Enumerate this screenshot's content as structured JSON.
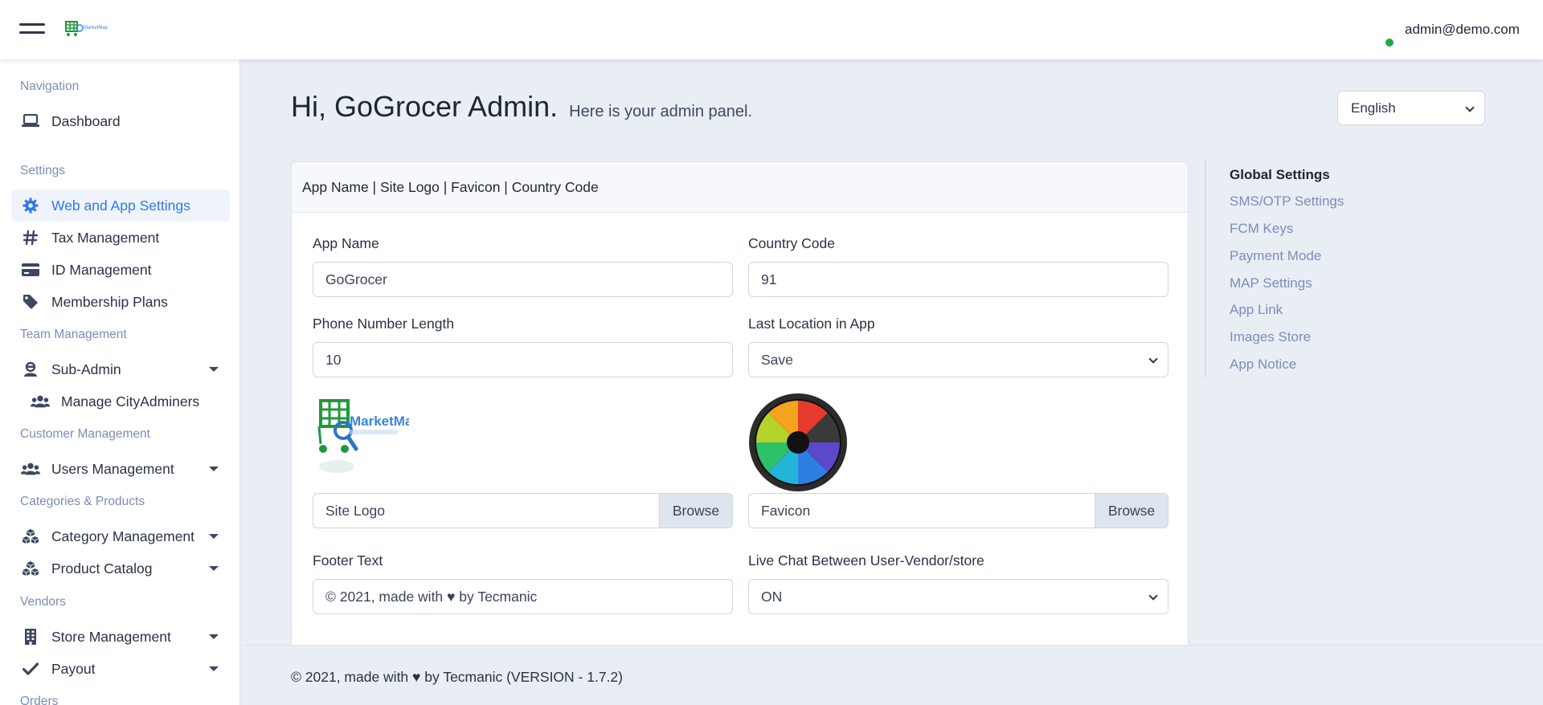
{
  "header": {
    "brand_text": "MarketMap",
    "user_email": "admin@demo.com"
  },
  "sidebar": {
    "sections": {
      "navigation": "Navigation",
      "settings": "Settings",
      "team": "Team Management",
      "customer": "Customer Management",
      "categories": "Categories & Products",
      "vendors": "Vendors",
      "orders": "Orders"
    },
    "items": {
      "dashboard": "Dashboard",
      "web_app_settings": "Web and App Settings",
      "tax": "Tax Management",
      "id_mgmt": "ID Management",
      "membership": "Membership Plans",
      "sub_admin": "Sub-Admin",
      "manage_city": "Manage CityAdminers",
      "users": "Users Management",
      "category": "Category Management",
      "product": "Product Catalog",
      "store": "Store Management",
      "payout": "Payout"
    }
  },
  "main": {
    "greeting": "Hi, GoGrocer Admin.",
    "greeting_sub": "Here is your admin panel.",
    "language": "English",
    "card_title": "App Name | Site Logo | Favicon | Country Code",
    "fields": {
      "app_name_label": "App Name",
      "app_name_value": "GoGrocer",
      "country_code_label": "Country Code",
      "country_code_value": "91",
      "phone_len_label": "Phone Number Length",
      "phone_len_value": "10",
      "last_location_label": "Last Location in App",
      "last_location_value": "Save",
      "site_logo_file": "Site Logo",
      "favicon_file": "Favicon",
      "browse": "Browse",
      "footer_text_label": "Footer Text",
      "footer_text_value": "© 2021, made with ♥ by Tecmanic",
      "live_chat_label": "Live Chat Between User-Vendor/store",
      "live_chat_value": "ON"
    }
  },
  "right_nav": {
    "items": [
      "Global Settings",
      "SMS/OTP Settings",
      "FCM Keys",
      "Payment Mode",
      "MAP Settings",
      "App Link",
      "Images Store",
      "App Notice"
    ]
  },
  "footer": {
    "text": "© 2021, made with ♥ by Tecmanic (VERSION - 1.7.2)"
  },
  "colors": {
    "accent": "#2f7ae5",
    "sidebar_heading": "#7c8db5",
    "status_online": "#1faa44",
    "page_bg": "#e9edf4"
  }
}
